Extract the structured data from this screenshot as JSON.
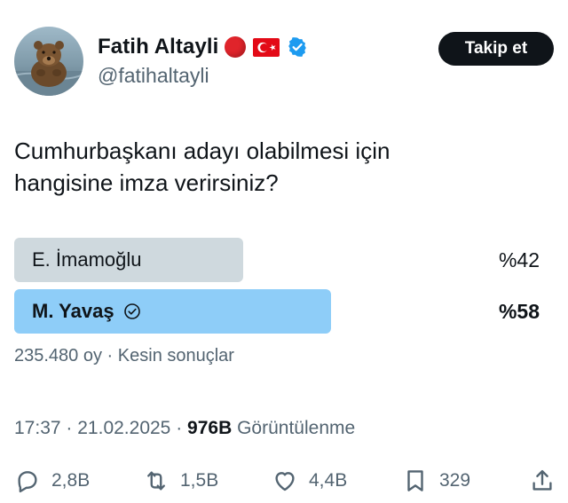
{
  "author": {
    "name": "Fatih Altayli",
    "handle": "@fatihaltayli",
    "follow_label": "Takip et"
  },
  "tweet": {
    "text_line1": "Cumhurbaşkanı adayı olabilmesi için",
    "text_line2": "hangisine imza verirsiniz?"
  },
  "poll": {
    "options": [
      {
        "label": "E. İmamoğlu",
        "percent_label": "%42",
        "percent": 42,
        "winner": false
      },
      {
        "label": "M. Yavaş",
        "percent_label": "%58",
        "percent": 58,
        "winner": true
      }
    ],
    "votes": "235.480 oy",
    "separator": "·",
    "status": "Kesin sonuçlar"
  },
  "meta": {
    "time": "17:37",
    "date": "21.02.2025",
    "separator": "·",
    "views_count": "976B",
    "views_label": "Görüntülenme"
  },
  "actions": {
    "replies": "2,8B",
    "reposts": "1,5B",
    "likes": "4,4B",
    "bookmarks": "329"
  },
  "colors": {
    "accent": "#1d9bf0",
    "winner_bar": "#8ecdf8",
    "loser_bar": "#cfd9de",
    "text": "#0f1419",
    "muted": "#536471"
  },
  "icons": {
    "name_emoji_1": "red-circle-icon",
    "name_emoji_2": "turkey-flag-icon",
    "verified": "verified-badge-icon",
    "reply": "reply-icon",
    "repost": "repost-icon",
    "like": "heart-icon",
    "bookmark": "bookmark-icon",
    "share": "share-icon",
    "poll_choice": "check-circle-icon"
  }
}
